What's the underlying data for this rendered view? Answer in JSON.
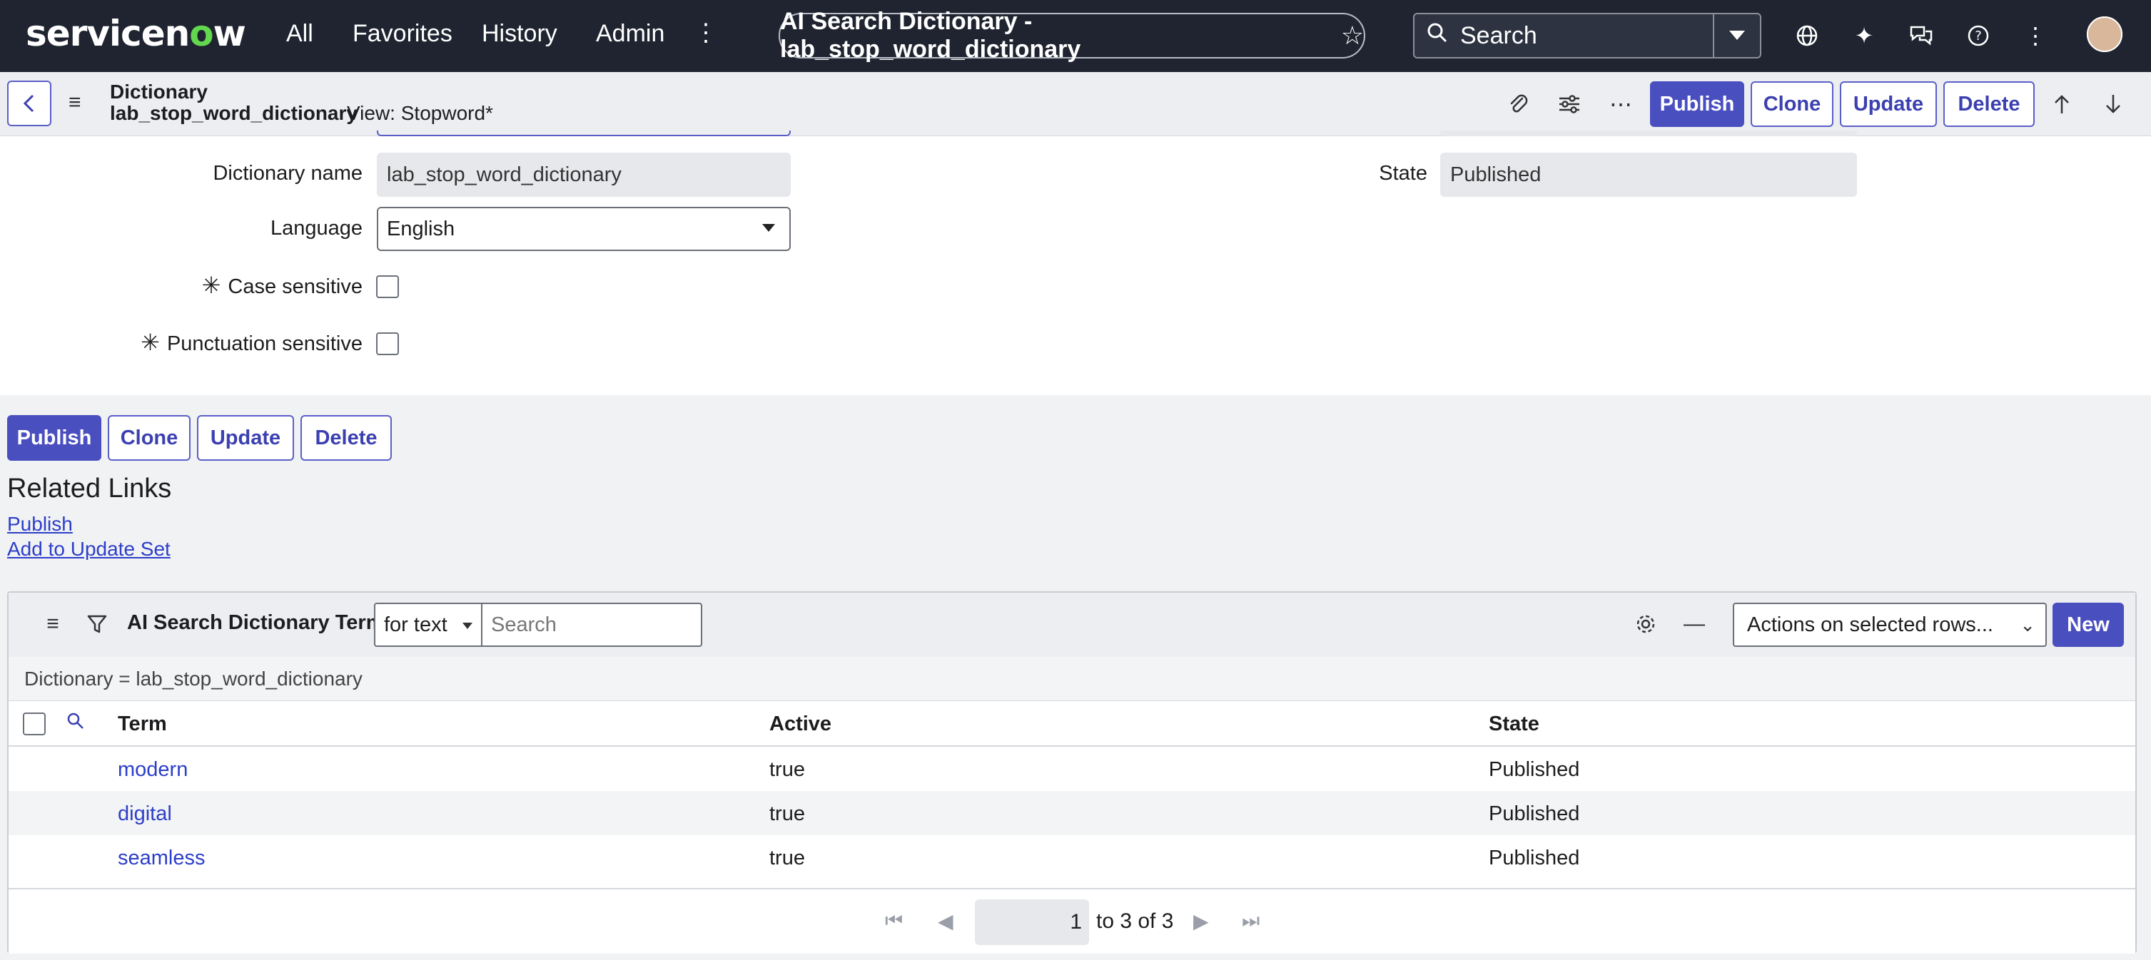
{
  "nav": {
    "logo_text": "servicenow",
    "links": [
      "All",
      "Favorites",
      "History",
      "Admin"
    ],
    "title": "AI Search Dictionary - lab_stop_word_dictionary",
    "search_placeholder": "Search"
  },
  "header": {
    "record_type": "Dictionary",
    "record_name": "lab_stop_word_dictionary",
    "view": "View: Stopword*",
    "buttons": [
      "Publish",
      "Clone",
      "Update",
      "Delete"
    ]
  },
  "form": {
    "dictionary_name_label": "Dictionary name",
    "dictionary_name_value": "lab_stop_word_dictionary",
    "language_label": "Language",
    "language_value": "English",
    "case_sensitive_label": "Case sensitive",
    "punctuation_sensitive_label": "Punctuation sensitive",
    "state_label": "State",
    "state_value": "Published",
    "case_sensitive_checked": false,
    "punctuation_sensitive_checked": false
  },
  "bottom_buttons": [
    "Publish",
    "Clone",
    "Update",
    "Delete"
  ],
  "related_links": {
    "title": "Related Links",
    "links": [
      "Publish",
      "Add to Update Set"
    ]
  },
  "related_list": {
    "title": "AI Search Dictionary Terms",
    "search_field": "for text",
    "search_placeholder": "Search",
    "actions_placeholder": "Actions on selected rows...",
    "new_label": "New",
    "filter_text": "Dictionary = lab_stop_word_dictionary",
    "columns": [
      "Term",
      "Active",
      "State"
    ],
    "rows": [
      {
        "term": "modern",
        "active": "true",
        "state": "Published"
      },
      {
        "term": "digital",
        "active": "true",
        "state": "Published"
      },
      {
        "term": "seamless",
        "active": "true",
        "state": "Published"
      }
    ],
    "pager": {
      "current": "1",
      "range_text": "to 3 of 3"
    }
  },
  "colors": {
    "nav_bg": "#1f2430",
    "primary": "#4a4fc0",
    "link": "#2d3ec8",
    "logo_accent": "#62d84e"
  },
  "icons": [
    "chevron-left-icon",
    "hamburger-icon",
    "star-icon",
    "search-icon",
    "globe-icon",
    "sparkle-icon",
    "chat-icon",
    "help-icon",
    "more-vertical-icon",
    "paperclip-icon",
    "settings-sliders-icon",
    "more-horizontal-icon",
    "arrow-up-icon",
    "arrow-down-icon",
    "filter-icon",
    "gear-icon",
    "minus-icon",
    "first-page-icon",
    "prev-page-icon",
    "next-page-icon",
    "last-page-icon"
  ]
}
